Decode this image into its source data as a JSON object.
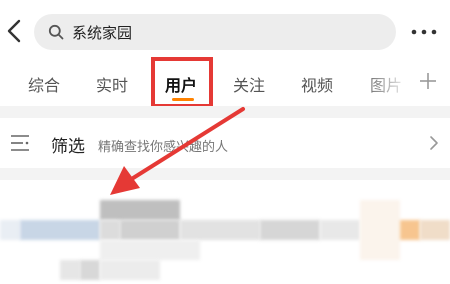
{
  "header": {
    "search_query": "系统家园"
  },
  "tabs": [
    {
      "label": "综合",
      "active": false
    },
    {
      "label": "实时",
      "active": false
    },
    {
      "label": "用户",
      "active": true
    },
    {
      "label": "关注",
      "active": false
    },
    {
      "label": "视频",
      "active": false
    },
    {
      "label": "图片",
      "active": false
    }
  ],
  "filter": {
    "label": "筛选",
    "hint": "精确查找你感兴趣的人"
  },
  "colors": {
    "accent": "#ff8200",
    "annotation": "#e53935"
  }
}
